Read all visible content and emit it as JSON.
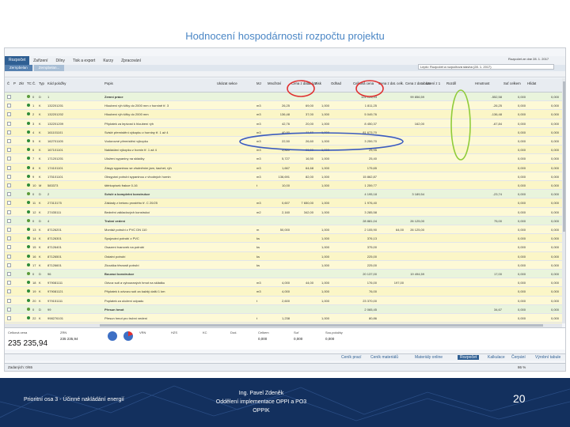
{
  "slide": {
    "title": "Hodnocení hospodárnosti rozpočtu projektu",
    "footer_left": "Prioritní osa 3 - Účinné nakládání energií",
    "footer_mid_lines": [
      "Ing. Pavel Zdeněk",
      "Oddělení implementace OPPI a PO3",
      "OPPIK"
    ],
    "page_number": "20"
  },
  "app": {
    "menu": [
      "Rozpočet",
      "Zařízení",
      "Dílny",
      "Tisk a export",
      "Kurzy",
      "Zpracování"
    ],
    "menu_active": 0,
    "doc_tabs": [
      "Zernpbelan",
      "Zernpbelan..."
    ],
    "combo_value": "Lepší: Rozpočet a rozpočtová stavba (28. 1. 2017)",
    "date_label": "Rozpočet ze dne 28. 1. 2017"
  },
  "table": {
    "columns": [
      "Č",
      "P",
      "Zkr",
      "TC",
      "Č.",
      "Typ",
      "Kód položky",
      "Popis",
      "Ukázat sekce",
      "MJ",
      "Množství",
      "Cena z databáze",
      "Zisk",
      "Odhad",
      "Celková cena",
      "Cena z dat. celk.",
      "Cena z databáze",
      "Ucení z 1",
      "Rozdíl",
      "Hmotnost",
      "Suť celkem",
      "Hlídat"
    ],
    "rows": [
      {
        "n": "0",
        "typ": "D",
        "kod": "1",
        "popis": "Zemní práce",
        "mj": "",
        "mn": "",
        "cena": "",
        "c1": "",
        "c2": "",
        "cel": "124 126,93",
        "cd": "",
        "cdb": "99 856,59",
        "u": "",
        "rz": "",
        "h": "-552,58",
        "s": "0,000",
        "ss": "0,000",
        "kind": "group"
      },
      {
        "n": "1",
        "typ": "K",
        "kod": "132201201",
        "popis": "Hloubení rýh šířky do 2000 mm v hornině tř. 3",
        "mj": "m3",
        "mn": "26,25",
        "cena": "69,00",
        "c1": "1,000",
        "c2": "",
        "cel": "1 811,25",
        "cd": "",
        "cdb": "",
        "u": "",
        "rz": "",
        "h": "-26,25",
        "s": "0,000",
        "ss": "0,000",
        "kind": "hl"
      },
      {
        "n": "2",
        "typ": "K",
        "kod": "132201202",
        "popis": "Hloubení rýh šířky do 2000 mm",
        "mj": "m3",
        "mn": "136,48",
        "cena": "37,00",
        "c1": "1,000",
        "c2": "",
        "cel": "5 049,76",
        "cd": "",
        "cdb": "",
        "u": "",
        "rz": "",
        "h": "-136,48",
        "s": "0,000",
        "ss": "0,000",
        "kind": "hl"
      },
      {
        "n": "3",
        "typ": "K",
        "kod": "132201209",
        "popis": "Příplatek za lepivost k hloubení rýh",
        "mj": "m3",
        "mn": "42,76",
        "cena": "20,00",
        "c1": "1,000",
        "c2": "",
        "cel": "8 450,37",
        "cd": "",
        "cdb": "162,00",
        "u": "",
        "rz": "",
        "h": "-67,84",
        "s": "0,000",
        "ss": "0,000",
        "kind": "hl"
      },
      {
        "n": "4",
        "typ": "K",
        "kod": "161101101",
        "popis": "Svislé přemístění výkopku z horniny tř. 1 až 4",
        "mj": "m3",
        "mn": "40,80",
        "cena": "11,60",
        "c1": "1,000",
        "c2": "",
        "cel": "81 673,70",
        "cd": "",
        "cdb": "",
        "u": "",
        "rz": "",
        "h": "",
        "s": "0,000",
        "ss": "0,000",
        "kind": "hl"
      },
      {
        "n": "5",
        "typ": "K",
        "kod": "162701105",
        "popis": "Vodorovné přemístění výkopku",
        "mj": "m3",
        "mn": "22,50",
        "cena": "26,60",
        "c1": "1,000",
        "c2": "",
        "cel": "3 259,70",
        "cd": "",
        "cdb": "",
        "u": "",
        "rz": "",
        "h": "",
        "s": "0,000",
        "ss": "0,000",
        "kind": "hl"
      },
      {
        "n": "6",
        "typ": "K",
        "kod": "167101101",
        "popis": "Nakládání výkopku z hornin tř. 1 až 4",
        "mj": "m3",
        "mn": "3,880",
        "cena": "99,00",
        "c1": "1,000",
        "c2": "",
        "cel": "25,95",
        "cd": "",
        "cdb": "",
        "u": "",
        "rz": "",
        "h": "",
        "s": "0,000",
        "ss": "0,000",
        "kind": "hl"
      },
      {
        "n": "7",
        "typ": "K",
        "kod": "171201201",
        "popis": "Uložení sypaniny na skládky",
        "mj": "m3",
        "mn": "5,727",
        "cena": "16,50",
        "c1": "1,000",
        "c2": "",
        "cel": "25,40",
        "cd": "",
        "cdb": "",
        "u": "",
        "rz": "",
        "h": "",
        "s": "0,000",
        "ss": "0,000",
        "kind": "hl"
      },
      {
        "n": "8",
        "typ": "K",
        "kod": "174101101",
        "popis": "Zásyp sypaninou se zhutněním jam, šachet, rýh",
        "mj": "m3",
        "mn": "1,667",
        "cena": "64,68",
        "c1": "1,000",
        "c2": "",
        "cel": "175,65",
        "cd": "",
        "cdb": "",
        "u": "",
        "rz": "",
        "h": "",
        "s": "0,000",
        "ss": "0,000",
        "kind": "hl"
      },
      {
        "n": "9",
        "typ": "K",
        "kod": "175101101",
        "popis": "Obsypání potrubí sypaninou z vhodných hornin",
        "mj": "m3",
        "mn": "136,691",
        "cena": "82,00",
        "c1": "1,000",
        "c2": "",
        "cel": "15 862,87",
        "cd": "",
        "cdb": "",
        "u": "",
        "rz": "",
        "h": "",
        "s": "0,000",
        "ss": "0,000",
        "kind": "hl"
      },
      {
        "n": "10",
        "typ": "M",
        "kod": "583373",
        "popis": "štěrkopísek frakce 0-16",
        "mj": "t",
        "mn": "10,00",
        "cena": "",
        "c1": "1,000",
        "c2": "",
        "cel": "1 259,77",
        "cd": "",
        "cdb": "",
        "u": "",
        "rz": "",
        "h": "",
        "s": "0,000",
        "ss": "0,000",
        "kind": "hl"
      },
      {
        "n": "0",
        "typ": "D",
        "kod": "2",
        "popis": "Svislé a kompletní konstrukce",
        "mj": "",
        "mn": "",
        "cena": "",
        "c1": "",
        "c2": "",
        "cel": "4 195,18",
        "cd": "",
        "cdb": "3 189,54",
        "u": "",
        "rz": "",
        "h": "-23,74",
        "s": "0,000",
        "ss": "0,000",
        "kind": "group"
      },
      {
        "n": "11",
        "typ": "K",
        "kod": "27313175",
        "popis": "Základy z betonu prostého tř. C 20/25",
        "mj": "m3",
        "mn": "0,607",
        "cena": "7 650,00",
        "c1": "1,000",
        "c2": "",
        "cel": "1 976,40",
        "cd": "",
        "cdb": "",
        "u": "",
        "rz": "",
        "h": "",
        "s": "0,000",
        "ss": "0,000",
        "kind": "hl"
      },
      {
        "n": "12",
        "typ": "K",
        "kod": "27435111",
        "popis": "Bednění základových konstrukcí",
        "mj": "m2",
        "mn": "2,160",
        "cena": "342,00",
        "c1": "1,000",
        "c2": "",
        "cel": "3 285,58",
        "cd": "",
        "cdb": "",
        "u": "",
        "rz": "",
        "h": "",
        "s": "0,000",
        "ss": "0,000",
        "kind": "hl"
      },
      {
        "n": "0",
        "typ": "D",
        "kod": "4",
        "popis": "Trubní vedení",
        "mj": "",
        "mn": "",
        "cena": "",
        "c1": "",
        "c2": "",
        "cel": "28 881,04",
        "cd": "",
        "cdb": "26 125,00",
        "u": "",
        "rz": "",
        "h": "75,00",
        "s": "0,000",
        "ss": "0,000",
        "kind": "group"
      },
      {
        "n": "13",
        "typ": "K",
        "kod": "87126201",
        "popis": "Montáž potrubí z PVC DN 110",
        "mj": "m",
        "mn": "50,000",
        "cena": "",
        "c1": "1,000",
        "c2": "",
        "cel": "2 105,90",
        "cd": "64,00",
        "cdb": "26 125,00",
        "u": "",
        "rz": "",
        "h": "",
        "s": "0,000",
        "ss": "0,000",
        "kind": "hl"
      },
      {
        "n": "14",
        "typ": "K",
        "kod": "87126301",
        "popis": "Spojování potrubí z PVC",
        "mj": "ks",
        "mn": "",
        "cena": "",
        "c1": "1,000",
        "c2": "",
        "cel": "376,13",
        "cd": "",
        "cdb": "",
        "u": "",
        "rz": "",
        "h": "",
        "s": "0,000",
        "ss": "0,000",
        "kind": "hl"
      },
      {
        "n": "15",
        "typ": "K",
        "kod": "87126401",
        "popis": "Osazení tvarovek na potrubí",
        "mj": "ks",
        "mn": "",
        "cena": "",
        "c1": "1,000",
        "c2": "",
        "cel": "375,00",
        "cd": "",
        "cdb": "",
        "u": "",
        "rz": "",
        "h": "",
        "s": "0,000",
        "ss": "0,000",
        "kind": "hl"
      },
      {
        "n": "16",
        "typ": "K",
        "kod": "87126501",
        "popis": "Ostatní potrubí",
        "mj": "ks",
        "mn": "",
        "cena": "",
        "c1": "1,000",
        "c2": "",
        "cel": "225,00",
        "cd": "",
        "cdb": "",
        "u": "",
        "rz": "",
        "h": "",
        "s": "0,000",
        "ss": "0,000",
        "kind": "hl"
      },
      {
        "n": "17",
        "typ": "K",
        "kod": "87126601",
        "popis": "Zkouška těsnosti potrubí",
        "mj": "ks",
        "mn": "",
        "cena": "",
        "c1": "1,000",
        "c2": "",
        "cel": "225,00",
        "cd": "",
        "cdb": "",
        "u": "",
        "rz": "",
        "h": "",
        "s": "0,000",
        "ss": "0,000",
        "kind": "hl"
      },
      {
        "n": "0",
        "typ": "D",
        "kod": "96",
        "popis": "Bourací konstrukce",
        "mj": "",
        "mn": "",
        "cena": "",
        "c1": "",
        "c2": "",
        "cel": "20 137,00",
        "cd": "",
        "cdb": "19 494,59",
        "u": "",
        "rz": "",
        "h": "17,00",
        "s": "0,000",
        "ss": "0,000",
        "kind": "group"
      },
      {
        "n": "18",
        "typ": "K",
        "kod": "979081111",
        "popis": "Odvoz suti a vybouraných hmot na skládku",
        "mj": "m3",
        "mn": "4,000",
        "cena": "44,00",
        "c1": "1,000",
        "c2": "",
        "cel": "176,00",
        "cd": "197,00",
        "cdb": "",
        "u": "",
        "rz": "",
        "h": "",
        "s": "0,000",
        "ss": "0,000",
        "kind": "hl"
      },
      {
        "n": "19",
        "typ": "K",
        "kod": "979081121",
        "popis": "Příplatek k odvozu suti za každý další 1 km",
        "mj": "m3",
        "mn": "4,000",
        "cena": "",
        "c1": "1,000",
        "c2": "",
        "cel": "76,00",
        "cd": "",
        "cdb": "",
        "u": "",
        "rz": "",
        "h": "",
        "s": "0,000",
        "ss": "0,000",
        "kind": "hl"
      },
      {
        "n": "20",
        "typ": "K",
        "kod": "979151111",
        "popis": "Poplatek za uložení odpadu",
        "mj": "t",
        "mn": "2,600",
        "cena": "",
        "c1": "1,000",
        "c2": "",
        "cel": "23 370,00",
        "cd": "",
        "cdb": "",
        "u": "",
        "rz": "",
        "h": "",
        "s": "0,000",
        "ss": "0,000",
        "kind": "hl"
      },
      {
        "n": "0",
        "typ": "D",
        "kod": "99",
        "popis": "Přesun hmot",
        "mj": "",
        "mn": "",
        "cena": "",
        "c1": "",
        "c2": "",
        "cel": "2 065,45",
        "cd": "",
        "cdb": "",
        "u": "",
        "rz": "",
        "h": "34,67",
        "s": "0,000",
        "ss": "0,000",
        "kind": "group"
      },
      {
        "n": "22",
        "typ": "K",
        "kod": "998276101",
        "popis": "Přesun hmot pro trubní vedení",
        "mj": "t",
        "mn": "1,238",
        "cena": "",
        "c1": "1,000",
        "c2": "",
        "cel": "80,86",
        "cd": "",
        "cdb": "",
        "u": "",
        "rz": "",
        "h": "",
        "s": "0,000",
        "ss": "0,000",
        "kind": "hl"
      },
      {
        "n": "23",
        "typ": "K",
        "kod": "998276124",
        "popis": "Příplatek k přesunu hmot",
        "mj": "t",
        "mn": "",
        "cena": "",
        "c1": "1,000",
        "c2": "",
        "cel": "",
        "cd": "",
        "cdb": "",
        "u": "",
        "rz": "",
        "h": "",
        "s": "0,000",
        "ss": "0,000",
        "kind": "hl"
      }
    ]
  },
  "summary": {
    "grand_label": "Celková cena",
    "grand_value": "235 235,94",
    "items": [
      {
        "label": "ZRN",
        "value": "235 235,94"
      },
      {
        "label": "VRN",
        "value": ""
      },
      {
        "label": "HZS",
        "value": ""
      },
      {
        "label": "KC",
        "value": ""
      },
      {
        "label": "Dod.",
        "value": ""
      },
      {
        "label": "Celkem",
        "value": "0,000"
      },
      {
        "label": "Suť",
        "value": "0,000"
      },
      {
        "label": "Sou.položky",
        "value": "0,000"
      }
    ]
  },
  "bottom_tabs": [
    "Ceník prací",
    "Ceník materiálů",
    "Materiály online",
    "Rozpočet",
    "Kalkulace",
    "Čerpání",
    "Výrobní tabule"
  ],
  "bottom_active": 3,
  "status": {
    "left": "Zadaných: 0/65",
    "zoom": "86 %"
  },
  "colors": {
    "group": "#e9f4dc",
    "hl": "#fbf6c7",
    "header": "#e8ecf1",
    "accent": "#2f5f93",
    "red_mark": "#e03030",
    "blue_mark": "#3b5bbf",
    "green_mark": "#8fcc3a",
    "footer": "#13305e"
  }
}
